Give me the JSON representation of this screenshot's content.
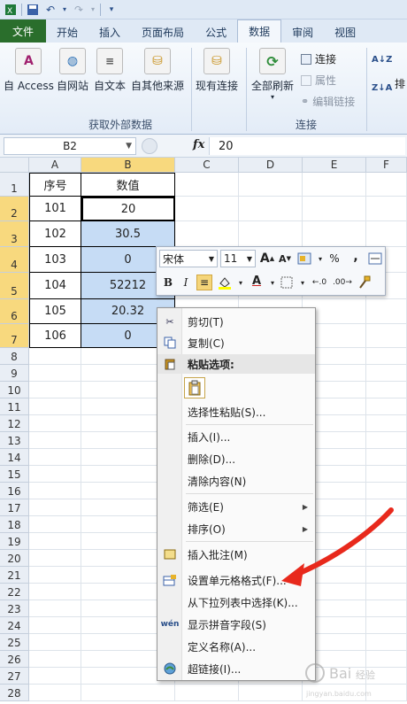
{
  "ribbon_tabs": [
    "文件",
    "开始",
    "插入",
    "页面布局",
    "公式",
    "数据",
    "审阅",
    "视图"
  ],
  "ribbon": {
    "buttons": [
      "自 Access",
      "自网站",
      "自文本",
      "自其他来源",
      "现有连接",
      "全部刷新"
    ],
    "group_external": "获取外部数据",
    "group_connections": "连接",
    "small_items": [
      "连接",
      "属性",
      "编辑链接"
    ],
    "sort_hint": "排"
  },
  "formula_bar": {
    "name_box": "B2",
    "fx": "fx",
    "value": "20"
  },
  "columns": [
    "A",
    "B",
    "C",
    "D",
    "E",
    "F"
  ],
  "rows": [
    "1",
    "2",
    "3",
    "4",
    "5",
    "6",
    "7",
    "8",
    "9",
    "10",
    "11",
    "12",
    "13",
    "14",
    "15",
    "16",
    "17",
    "18",
    "19",
    "20",
    "21",
    "22",
    "23",
    "24",
    "25",
    "26",
    "27",
    "28"
  ],
  "table": {
    "headers": [
      "序号",
      "数值"
    ],
    "data": [
      [
        "101",
        "20"
      ],
      [
        "102",
        "30.5"
      ],
      [
        "103",
        "0"
      ],
      [
        "104",
        "52212"
      ],
      [
        "105",
        "20.32"
      ],
      [
        "106",
        "0"
      ]
    ]
  },
  "mini_toolbar": {
    "font": "宋体",
    "size": "11",
    "bold": "B",
    "italic": "I",
    "percent": "%",
    "comma": ","
  },
  "context_menu": {
    "cut": "剪切(T)",
    "copy": "复制(C)",
    "paste_header": "粘贴选项:",
    "paste_special": "选择性粘贴(S)...",
    "insert": "插入(I)...",
    "delete": "删除(D)...",
    "clear": "清除内容(N)",
    "filter": "筛选(E)",
    "sort": "排序(O)",
    "insert_comment": "插入批注(M)",
    "format_cells": "设置单元格格式(F)...",
    "pick_list": "从下拉列表中选择(K)...",
    "phonetic": "显示拼音字段(S)",
    "define_name": "定义名称(A)...",
    "hyperlink": "超链接(I)..."
  },
  "colors": {
    "file_tab": "#2a6e2c",
    "selection": "#c6dcf5",
    "header_sel": "#f8d97e",
    "arrow": "#e8291c"
  }
}
